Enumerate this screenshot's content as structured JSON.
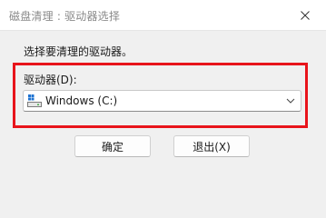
{
  "window": {
    "title": "磁盘清理 : 驱动器选择",
    "close_icon": "close-icon"
  },
  "dialog": {
    "instruction": "选择要清理的驱动器。",
    "drive_label": "驱动器(D):",
    "drive_select": {
      "selected": "Windows (C:)",
      "icon": "windows-drive-icon"
    },
    "highlight_color": "#e8141b",
    "buttons": {
      "ok_label": "确定",
      "exit_label": "退出(X)"
    }
  }
}
